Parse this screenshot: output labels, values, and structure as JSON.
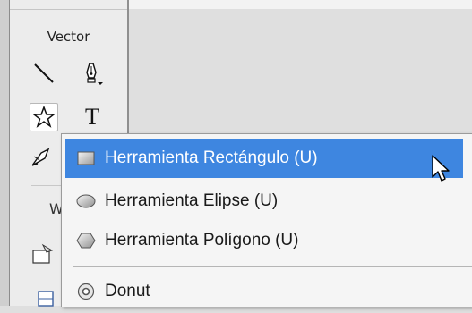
{
  "toolbar": {
    "section_label": "Vector",
    "tools": [
      {
        "name": "line-tool",
        "icon": "line-icon"
      },
      {
        "name": "pen-tool",
        "icon": "pen-icon"
      },
      {
        "name": "shape-tool",
        "icon": "star-icon",
        "selected": true
      },
      {
        "name": "text-tool",
        "icon": "text-icon",
        "glyph": "T"
      },
      {
        "name": "freeform-tool",
        "icon": "knife-icon"
      }
    ],
    "partial_section_letter": "W"
  },
  "menu": {
    "items": [
      {
        "label": "Herramienta Rectángulo (U)",
        "icon": "rectangle-icon",
        "highlighted": true
      },
      {
        "label": "Herramienta Elipse (U)",
        "icon": "ellipse-icon"
      },
      {
        "label": "Herramienta Polígono (U)",
        "icon": "polygon-icon"
      },
      {
        "label": "Donut",
        "icon": "donut-icon"
      }
    ]
  },
  "colors": {
    "highlight": "#3e86e0",
    "menu_bg": "#f5f5f5",
    "toolbar_bg": "#ececec"
  }
}
